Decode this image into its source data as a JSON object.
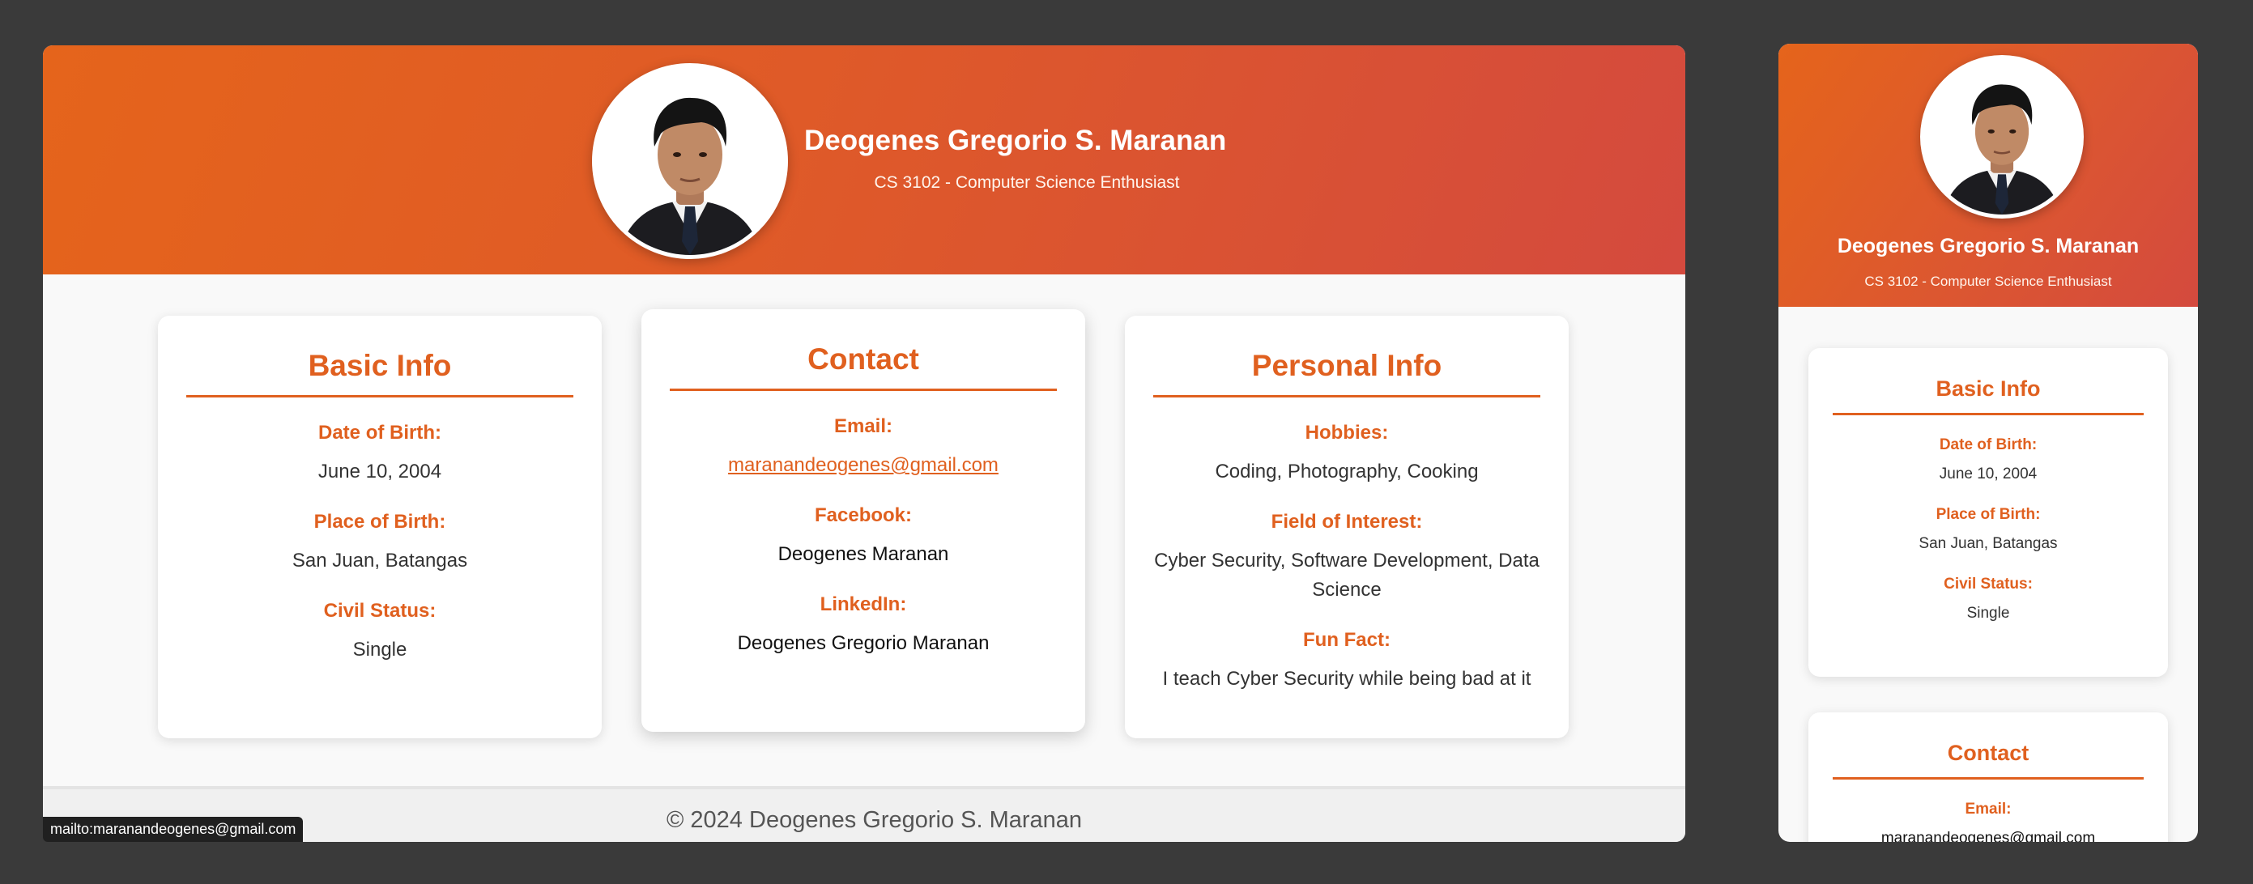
{
  "profile": {
    "name": "Deogenes Gregorio S. Maranan",
    "tagline": "CS 3102 - Computer Science Enthusiast"
  },
  "basic_info": {
    "title": "Basic Info",
    "dob_label": "Date of Birth:",
    "dob_value": "June 10, 2004",
    "pob_label": "Place of Birth:",
    "pob_value": "San Juan, Batangas",
    "civil_label": "Civil Status:",
    "civil_value": "Single"
  },
  "contact": {
    "title": "Contact",
    "email_label": "Email:",
    "email_value": "maranandeogenes@gmail.com",
    "facebook_label": "Facebook:",
    "facebook_value": "Deogenes Maranan",
    "linkedin_label": "LinkedIn:",
    "linkedin_value": "Deogenes Gregorio Maranan"
  },
  "personal_info": {
    "title": "Personal Info",
    "hobbies_label": "Hobbies:",
    "hobbies_value": "Coding, Photography, Cooking",
    "interest_label": "Field of Interest:",
    "interest_value": "Cyber Security, Software Development, Data Science",
    "funfact_label": "Fun Fact:",
    "funfact_value": "I teach Cyber Security while being bad at it"
  },
  "footer": {
    "text": "© 2024 Deogenes Gregorio S. Maranan"
  },
  "status_bar": {
    "link_preview": "mailto:maranandeogenes@gmail.com"
  },
  "colors": {
    "accent": "#e0601f",
    "banner_start": "#e5641b",
    "banner_end": "#d44a3e",
    "page_bg": "#3a3a3a"
  }
}
